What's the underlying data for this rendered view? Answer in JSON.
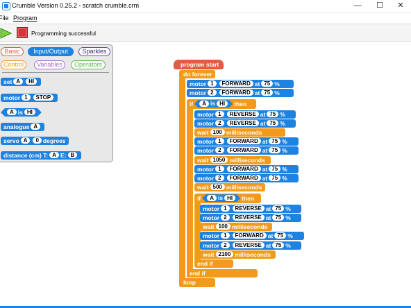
{
  "window": {
    "title": "Crumble Version 0.25.2 - scratch crumble.crm",
    "minimize": "—",
    "maximize": "☐",
    "close": "✕"
  },
  "menu": {
    "file": "File",
    "program": "Program"
  },
  "toolbar": {
    "status": "Programming successful"
  },
  "palette": {
    "tabs": {
      "basic": "Basic",
      "io": "Input/Output",
      "sparkles": "Sparkles",
      "control": "Control",
      "variables": "Variables",
      "operators": "Operators"
    },
    "set_block": {
      "label": "set",
      "var": "A",
      "value": "HI"
    },
    "motor_block": {
      "label": "motor",
      "num": "1",
      "state": "STOP"
    },
    "is_block": {
      "var": "A",
      "is": "is",
      "value": "HI"
    },
    "analogue_block": {
      "label": "analogue",
      "var": "A"
    },
    "servo_block": {
      "label": "servo",
      "var": "A",
      "value": "0",
      "unit": "degrees"
    },
    "distance_block": {
      "label": "distance (cm)",
      "t": "T:",
      "t_val": "A",
      "e": "E:",
      "e_val": "B"
    }
  },
  "program": {
    "start": "program start",
    "forever": "do forever",
    "motor": "motor",
    "at": "at",
    "percent": "%",
    "forward": "FORWARD",
    "reverse": "REVERSE",
    "one": "1",
    "two": "2",
    "speed": "75",
    "if": "if",
    "then": "then",
    "var": "A",
    "is": "is",
    "hi": "HI",
    "wait": "wait",
    "ms": "milliseconds",
    "wait1": "100",
    "wait2": "1050",
    "wait3": "500",
    "wait4": "100",
    "wait5": "2100",
    "endif": "end if",
    "loop": "loop"
  },
  "colors": {
    "blue": "#1e82e0",
    "orange": "#f39a1a",
    "red": "#e45a42"
  }
}
